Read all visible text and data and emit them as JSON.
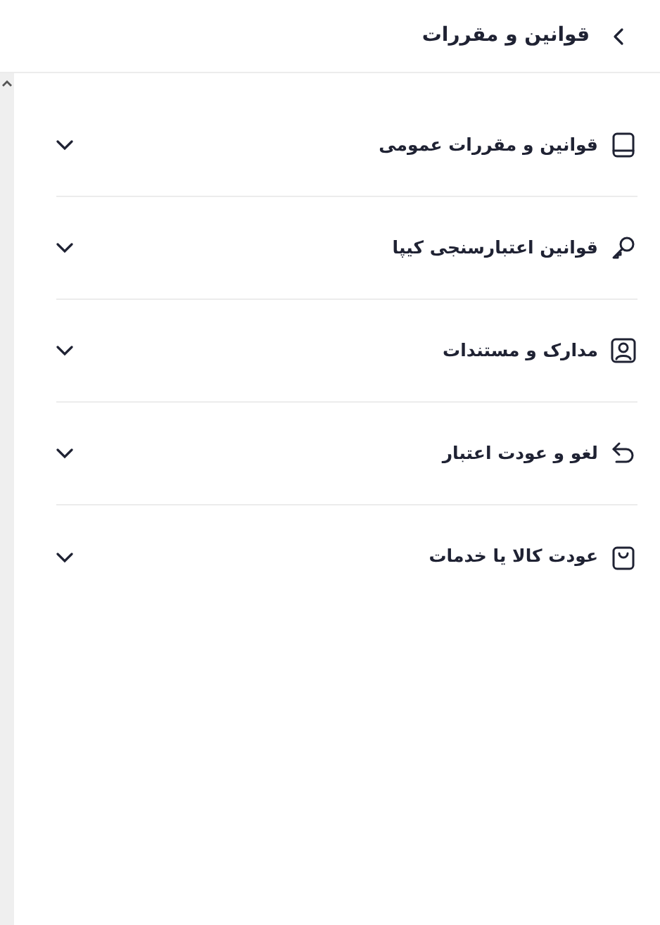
{
  "header": {
    "title": "قوانین و مقررات"
  },
  "sections": [
    {
      "title": "قوانین و مقررات عمومی",
      "expanded": false
    },
    {
      "title": "قوانین اعتبارسنجی کیپا",
      "expanded": false
    },
    {
      "title": "مدارک و مستندات",
      "expanded": false
    },
    {
      "title": "لغو و عودت اعتبار",
      "expanded": false
    },
    {
      "title": "عودت کالا یا خدمات",
      "expanded": false
    }
  ]
}
